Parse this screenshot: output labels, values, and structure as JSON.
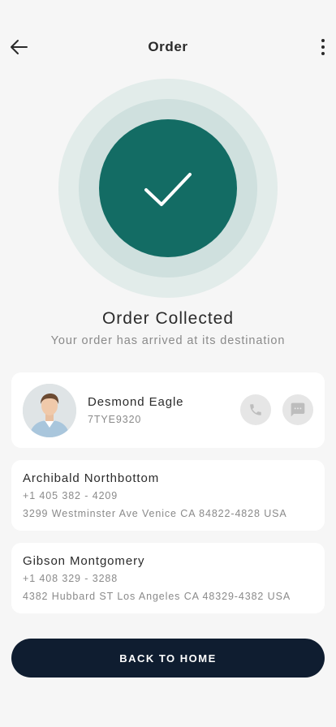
{
  "header": {
    "title": "Order",
    "back_icon": "arrow-left-icon",
    "more_icon": "more-vertical-icon"
  },
  "status": {
    "icon": "check-icon",
    "title": "Order Collected",
    "subtitle": "Your order has arrived at its destination",
    "colors": {
      "accent": "#136c64",
      "ring_mid": "#cfe0de",
      "ring_outer": "#e2ecea"
    }
  },
  "driver": {
    "name": "Desmond Eagle",
    "code": "7TYE9320",
    "call_icon": "phone-icon",
    "message_icon": "message-icon"
  },
  "addresses": [
    {
      "name": "Archibald Northbottom",
      "phone": "+1 405 382 - 4209",
      "address": "3299 Westminster Ave Venice CA 84822-4828 USA"
    },
    {
      "name": "Gibson Montgomery",
      "phone": "+1 408 329 - 3288",
      "address": "4382 Hubbard ST Los Angeles CA 48329-4382 USA"
    }
  ],
  "actions": {
    "back_home_label": "BACK TO HOME",
    "button_color": "#0f1d30"
  }
}
